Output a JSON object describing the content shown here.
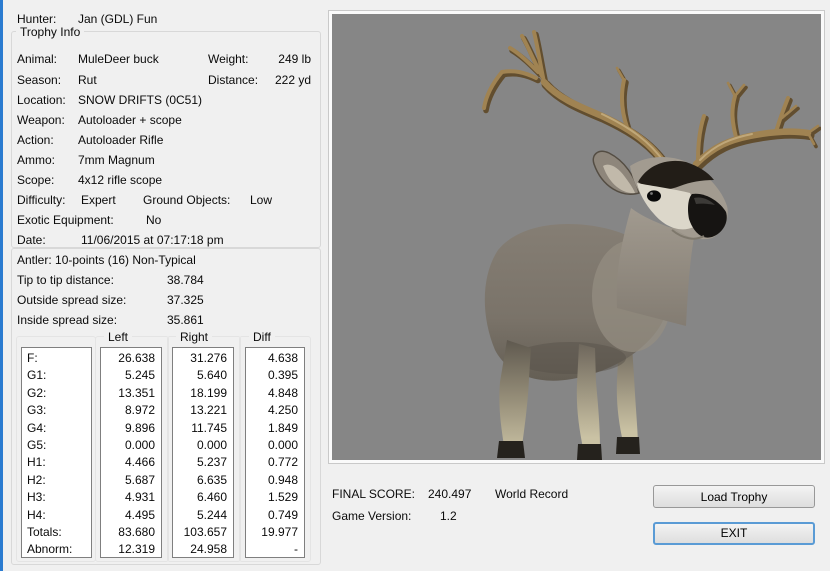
{
  "colors": {
    "window_bg": "#f0f0f0",
    "window_edge_blue": "#2b7bd0",
    "groupbox_border": "#d8d8d8",
    "listbox_border": "#7f7f7f",
    "viewer_bg": "#868686",
    "button_border": "#989898",
    "focus_border": "#5a9bd5",
    "deer_body": "#7d766c",
    "deer_antler": "#a08352",
    "deer_muzzle": "#dcd7ca",
    "deer_mask": "#221d17"
  },
  "hunter": {
    "label": "Hunter:",
    "value": "Jan (GDL) Fun"
  },
  "trophy_info": {
    "title": "Trophy Info",
    "fields": {
      "animal": {
        "label": "Animal:",
        "value": "MuleDeer buck"
      },
      "weight": {
        "label": "Weight:",
        "value": "249 lb"
      },
      "season": {
        "label": "Season:",
        "value": "Rut"
      },
      "distance": {
        "label": "Distance:",
        "value": "222 yd"
      },
      "location": {
        "label": "Location:",
        "value": "SNOW DRIFTS (0C51)"
      },
      "weapon": {
        "label": "Weapon:",
        "value": "Autoloader + scope"
      },
      "action": {
        "label": "Action:",
        "value": "Autoloader Rifle"
      },
      "ammo": {
        "label": "Ammo:",
        "value": "7mm Magnum"
      },
      "scope": {
        "label": "Scope:",
        "value": "4x12 rifle scope"
      },
      "difficulty": {
        "label": "Difficulty:",
        "value": "Expert"
      },
      "ground_objects": {
        "label": "Ground Objects:",
        "value": "Low"
      },
      "exotic": {
        "label": "Exotic Equipment:",
        "value": "No"
      },
      "date": {
        "label": "Date:",
        "value": "11/06/2015 at 07:17:18 pm"
      }
    }
  },
  "antler_info": {
    "antler_line": "Antler: 10-points (16) Non-Typical",
    "tip_to_tip": {
      "label": "Tip to tip distance:",
      "value": "38.784"
    },
    "outside_spread": {
      "label": "Outside spread size:",
      "value": "37.325"
    },
    "inside_spread": {
      "label": "Inside spread size:",
      "value": "35.861"
    }
  },
  "measurements": {
    "columns": {
      "left": "Left",
      "right": "Right",
      "diff": "Diff"
    },
    "row_labels": [
      "F:",
      "G1:",
      "G2:",
      "G3:",
      "G4:",
      "G5:",
      "H1:",
      "H2:",
      "H3:",
      "H4:",
      "Totals:",
      "Abnorm:"
    ],
    "left": [
      "26.638",
      "5.245",
      "13.351",
      "8.972",
      "9.896",
      "0.000",
      "4.466",
      "5.687",
      "4.931",
      "4.495",
      "83.680",
      "12.319"
    ],
    "right": [
      "31.276",
      "5.640",
      "18.199",
      "13.221",
      "11.745",
      "0.000",
      "5.237",
      "6.635",
      "6.460",
      "5.244",
      "103.657",
      "24.958"
    ],
    "diff": [
      "4.638",
      "0.395",
      "4.848",
      "4.250",
      "1.849",
      "0.000",
      "0.772",
      "0.948",
      "1.529",
      "0.749",
      "19.977",
      "-"
    ]
  },
  "viewer": {
    "description": "3D render of mule deer buck trophy on gray background"
  },
  "footer": {
    "final_score_label": "FINAL SCORE:",
    "final_score_value": "240.497",
    "record_text": "World Record",
    "game_version_label": "Game Version:",
    "game_version_value": "1.2"
  },
  "buttons": {
    "load_trophy": "Load Trophy",
    "exit": "EXIT"
  }
}
